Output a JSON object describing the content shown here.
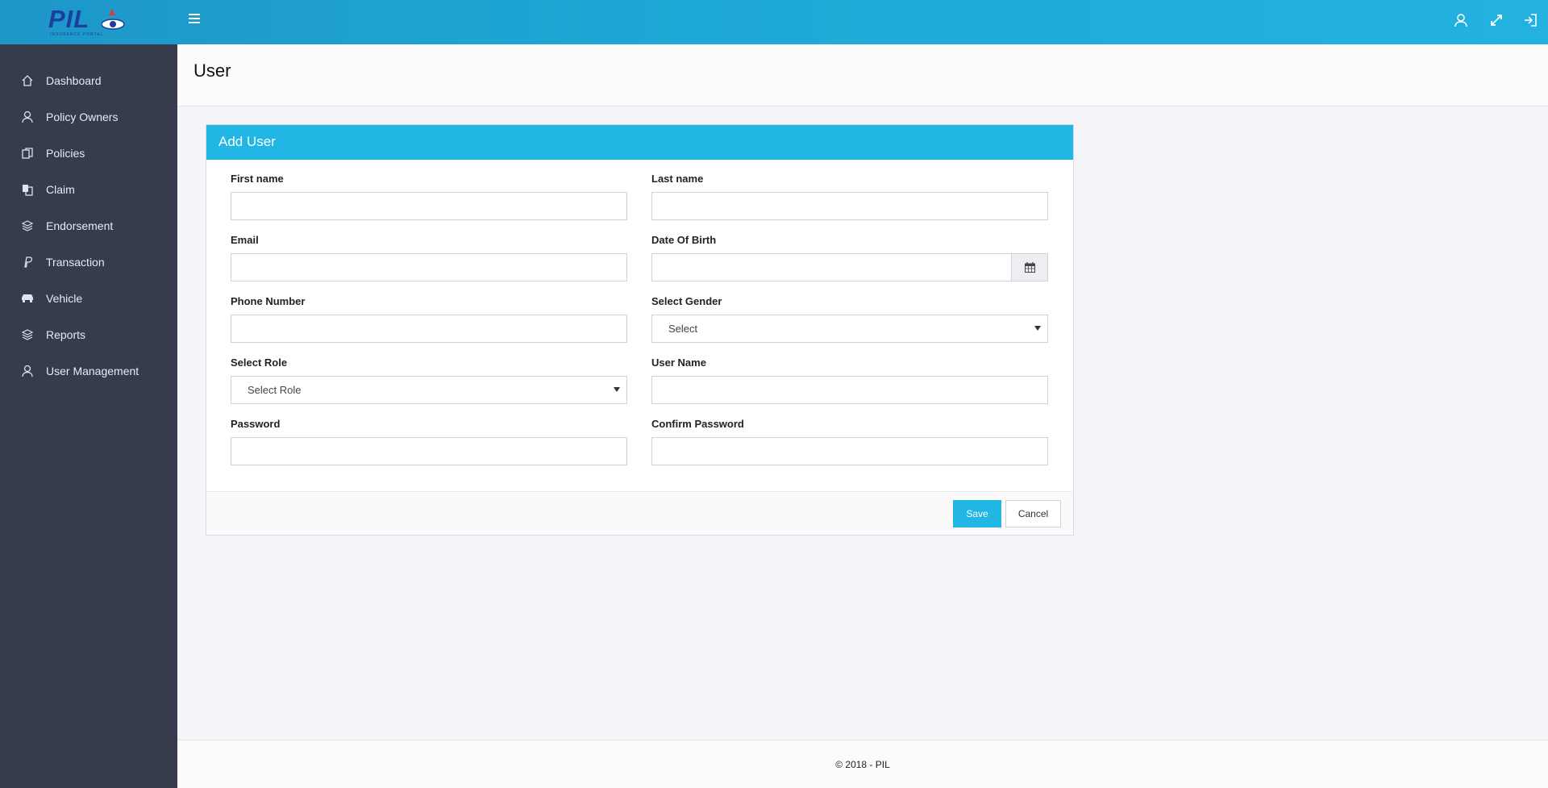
{
  "app": {
    "logo_text": "PIL",
    "logo_subtext": "INSURANCE PORTAL"
  },
  "colors": {
    "accent": "#22b6e4",
    "sidebar_bg": "#363b4e",
    "topbar": "#1ea7d6"
  },
  "topbar": {
    "icons": [
      "menu-icon",
      "user-icon",
      "fullscreen-icon",
      "logout-icon"
    ]
  },
  "sidebar": {
    "items": [
      {
        "label": "Dashboard",
        "icon": "home-icon"
      },
      {
        "label": "Policy Owners",
        "icon": "user-icon"
      },
      {
        "label": "Policies",
        "icon": "copy-icon"
      },
      {
        "label": "Claim",
        "icon": "file-icon"
      },
      {
        "label": "Endorsement",
        "icon": "layers-icon"
      },
      {
        "label": "Transaction",
        "icon": "paypal-icon"
      },
      {
        "label": "Vehicle",
        "icon": "car-icon"
      },
      {
        "label": "Reports",
        "icon": "layers-icon"
      },
      {
        "label": "User Management",
        "icon": "user-icon"
      }
    ]
  },
  "page": {
    "title": "User"
  },
  "form": {
    "title": "Add User",
    "first_name": {
      "label": "First name",
      "value": ""
    },
    "last_name": {
      "label": "Last name",
      "value": ""
    },
    "email": {
      "label": "Email",
      "value": ""
    },
    "dob": {
      "label": "Date Of Birth",
      "value": ""
    },
    "phone": {
      "label": "Phone Number",
      "value": ""
    },
    "gender": {
      "label": "Select Gender",
      "selected": "Select"
    },
    "role": {
      "label": "Select Role",
      "selected": "Select Role"
    },
    "username": {
      "label": "User Name",
      "value": ""
    },
    "password": {
      "label": "Password",
      "value": ""
    },
    "confirm_password": {
      "label": "Confirm Password",
      "value": ""
    },
    "save_label": "Save",
    "cancel_label": "Cancel"
  },
  "footer": {
    "text": "© 2018 - PIL"
  }
}
